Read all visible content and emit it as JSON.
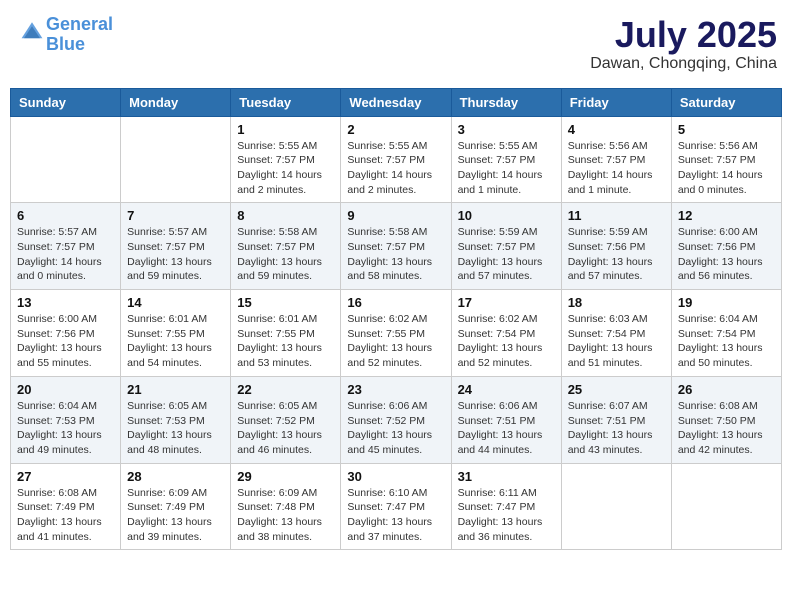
{
  "header": {
    "logo_line1": "General",
    "logo_line2": "Blue",
    "month_year": "July 2025",
    "location": "Dawan, Chongqing, China"
  },
  "weekdays": [
    "Sunday",
    "Monday",
    "Tuesday",
    "Wednesday",
    "Thursday",
    "Friday",
    "Saturday"
  ],
  "rows": [
    [
      {
        "day": "",
        "detail": ""
      },
      {
        "day": "",
        "detail": ""
      },
      {
        "day": "1",
        "detail": "Sunrise: 5:55 AM\nSunset: 7:57 PM\nDaylight: 14 hours\nand 2 minutes."
      },
      {
        "day": "2",
        "detail": "Sunrise: 5:55 AM\nSunset: 7:57 PM\nDaylight: 14 hours\nand 2 minutes."
      },
      {
        "day": "3",
        "detail": "Sunrise: 5:55 AM\nSunset: 7:57 PM\nDaylight: 14 hours\nand 1 minute."
      },
      {
        "day": "4",
        "detail": "Sunrise: 5:56 AM\nSunset: 7:57 PM\nDaylight: 14 hours\nand 1 minute."
      },
      {
        "day": "5",
        "detail": "Sunrise: 5:56 AM\nSunset: 7:57 PM\nDaylight: 14 hours\nand 0 minutes."
      }
    ],
    [
      {
        "day": "6",
        "detail": "Sunrise: 5:57 AM\nSunset: 7:57 PM\nDaylight: 14 hours\nand 0 minutes."
      },
      {
        "day": "7",
        "detail": "Sunrise: 5:57 AM\nSunset: 7:57 PM\nDaylight: 13 hours\nand 59 minutes."
      },
      {
        "day": "8",
        "detail": "Sunrise: 5:58 AM\nSunset: 7:57 PM\nDaylight: 13 hours\nand 59 minutes."
      },
      {
        "day": "9",
        "detail": "Sunrise: 5:58 AM\nSunset: 7:57 PM\nDaylight: 13 hours\nand 58 minutes."
      },
      {
        "day": "10",
        "detail": "Sunrise: 5:59 AM\nSunset: 7:57 PM\nDaylight: 13 hours\nand 57 minutes."
      },
      {
        "day": "11",
        "detail": "Sunrise: 5:59 AM\nSunset: 7:56 PM\nDaylight: 13 hours\nand 57 minutes."
      },
      {
        "day": "12",
        "detail": "Sunrise: 6:00 AM\nSunset: 7:56 PM\nDaylight: 13 hours\nand 56 minutes."
      }
    ],
    [
      {
        "day": "13",
        "detail": "Sunrise: 6:00 AM\nSunset: 7:56 PM\nDaylight: 13 hours\nand 55 minutes."
      },
      {
        "day": "14",
        "detail": "Sunrise: 6:01 AM\nSunset: 7:55 PM\nDaylight: 13 hours\nand 54 minutes."
      },
      {
        "day": "15",
        "detail": "Sunrise: 6:01 AM\nSunset: 7:55 PM\nDaylight: 13 hours\nand 53 minutes."
      },
      {
        "day": "16",
        "detail": "Sunrise: 6:02 AM\nSunset: 7:55 PM\nDaylight: 13 hours\nand 52 minutes."
      },
      {
        "day": "17",
        "detail": "Sunrise: 6:02 AM\nSunset: 7:54 PM\nDaylight: 13 hours\nand 52 minutes."
      },
      {
        "day": "18",
        "detail": "Sunrise: 6:03 AM\nSunset: 7:54 PM\nDaylight: 13 hours\nand 51 minutes."
      },
      {
        "day": "19",
        "detail": "Sunrise: 6:04 AM\nSunset: 7:54 PM\nDaylight: 13 hours\nand 50 minutes."
      }
    ],
    [
      {
        "day": "20",
        "detail": "Sunrise: 6:04 AM\nSunset: 7:53 PM\nDaylight: 13 hours\nand 49 minutes."
      },
      {
        "day": "21",
        "detail": "Sunrise: 6:05 AM\nSunset: 7:53 PM\nDaylight: 13 hours\nand 48 minutes."
      },
      {
        "day": "22",
        "detail": "Sunrise: 6:05 AM\nSunset: 7:52 PM\nDaylight: 13 hours\nand 46 minutes."
      },
      {
        "day": "23",
        "detail": "Sunrise: 6:06 AM\nSunset: 7:52 PM\nDaylight: 13 hours\nand 45 minutes."
      },
      {
        "day": "24",
        "detail": "Sunrise: 6:06 AM\nSunset: 7:51 PM\nDaylight: 13 hours\nand 44 minutes."
      },
      {
        "day": "25",
        "detail": "Sunrise: 6:07 AM\nSunset: 7:51 PM\nDaylight: 13 hours\nand 43 minutes."
      },
      {
        "day": "26",
        "detail": "Sunrise: 6:08 AM\nSunset: 7:50 PM\nDaylight: 13 hours\nand 42 minutes."
      }
    ],
    [
      {
        "day": "27",
        "detail": "Sunrise: 6:08 AM\nSunset: 7:49 PM\nDaylight: 13 hours\nand 41 minutes."
      },
      {
        "day": "28",
        "detail": "Sunrise: 6:09 AM\nSunset: 7:49 PM\nDaylight: 13 hours\nand 39 minutes."
      },
      {
        "day": "29",
        "detail": "Sunrise: 6:09 AM\nSunset: 7:48 PM\nDaylight: 13 hours\nand 38 minutes."
      },
      {
        "day": "30",
        "detail": "Sunrise: 6:10 AM\nSunset: 7:47 PM\nDaylight: 13 hours\nand 37 minutes."
      },
      {
        "day": "31",
        "detail": "Sunrise: 6:11 AM\nSunset: 7:47 PM\nDaylight: 13 hours\nand 36 minutes."
      },
      {
        "day": "",
        "detail": ""
      },
      {
        "day": "",
        "detail": ""
      }
    ]
  ]
}
